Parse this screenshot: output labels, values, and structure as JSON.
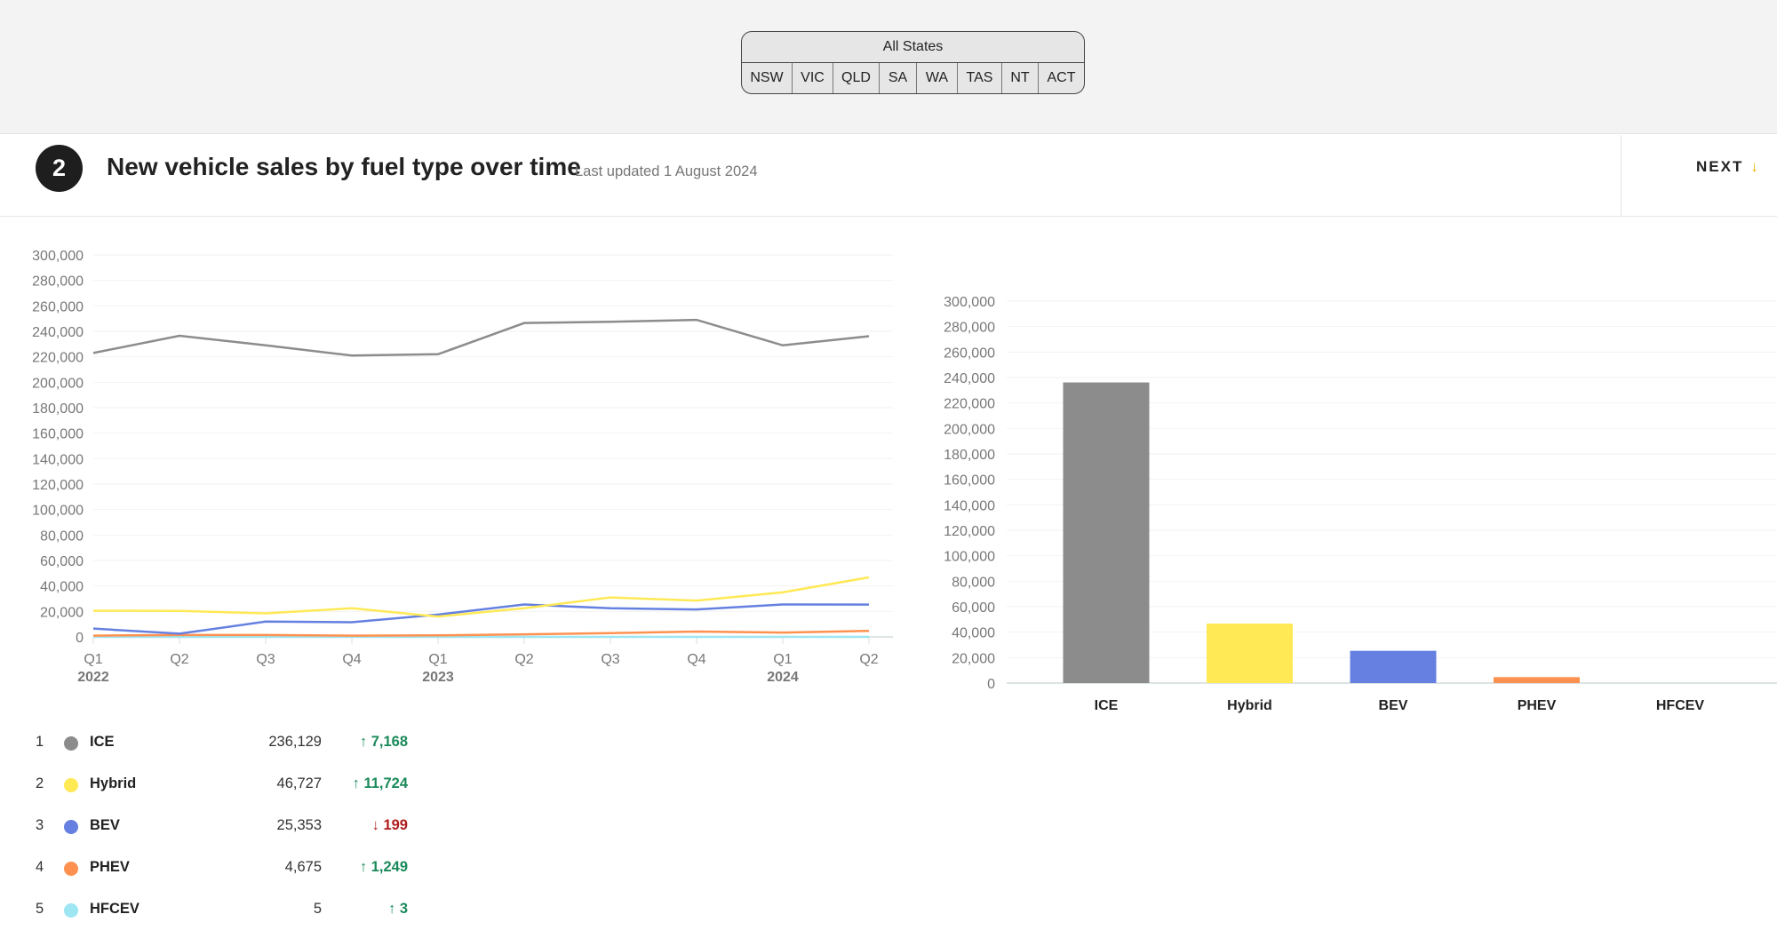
{
  "state_selector": {
    "all_label": "All States",
    "states": [
      "NSW",
      "VIC",
      "QLD",
      "SA",
      "WA",
      "TAS",
      "NT",
      "ACT"
    ]
  },
  "section": {
    "number": "2",
    "title": "New vehicle sales by fuel type over time",
    "last_updated": "Last updated 1 August 2024",
    "next_label": "NEXT",
    "next_icon": "arrow-down-icon"
  },
  "colors": {
    "ICE": "#8c8c8c",
    "Hybrid": "#ffe955",
    "BEV": "#6580e0",
    "PHEV": "#ff9150",
    "HFCEV": "#9de6f2",
    "up": "#1a8a5a",
    "down": "#b01c1c"
  },
  "chart_data": [
    {
      "type": "line",
      "x": [
        "Q1",
        "Q2",
        "Q3",
        "Q4",
        "Q1",
        "Q2",
        "Q3",
        "Q4",
        "Q1",
        "Q2"
      ],
      "year_labels": [
        {
          "index": 0,
          "label": "2022"
        },
        {
          "index": 4,
          "label": "2023"
        },
        {
          "index": 8,
          "label": "2024"
        }
      ],
      "ylim": [
        0,
        300000
      ],
      "yticks": [
        "0",
        "20,000",
        "40,000",
        "60,000",
        "80,000",
        "100,000",
        "120,000",
        "140,000",
        "160,000",
        "180,000",
        "200,000",
        "220,000",
        "240,000",
        "260,000",
        "280,000",
        "300,000"
      ],
      "grid": true,
      "series": [
        {
          "name": "ICE",
          "values": [
            223000,
            236500,
            229000,
            221000,
            222000,
            246500,
            247500,
            249000,
            229000,
            236129
          ]
        },
        {
          "name": "Hybrid",
          "values": [
            20500,
            20400,
            18500,
            22500,
            16000,
            22500,
            31000,
            28500,
            35000,
            46727
          ]
        },
        {
          "name": "BEV",
          "values": [
            6500,
            2500,
            12000,
            11500,
            17500,
            25500,
            22500,
            21500,
            25500,
            25353
          ]
        },
        {
          "name": "PHEV",
          "values": [
            1000,
            1500,
            1500,
            1000,
            1200,
            2000,
            3000,
            4200,
            3400,
            4675
          ]
        },
        {
          "name": "HFCEV",
          "values": [
            1,
            2,
            2,
            1,
            1,
            2,
            2,
            3,
            2,
            5
          ]
        }
      ]
    },
    {
      "type": "bar",
      "categories": [
        "ICE",
        "Hybrid",
        "BEV",
        "PHEV",
        "HFCEV"
      ],
      "values": [
        236129,
        46727,
        25353,
        4675,
        5
      ],
      "ylim": [
        0,
        300000
      ],
      "yticks": [
        "0",
        "20,000",
        "40,000",
        "60,000",
        "80,000",
        "100,000",
        "120,000",
        "140,000",
        "160,000",
        "180,000",
        "200,000",
        "220,000",
        "240,000",
        "260,000",
        "280,000",
        "300,000"
      ],
      "grid": true
    }
  ],
  "legend": [
    {
      "rank": "1",
      "name": "ICE",
      "value": "236,129",
      "change": "↑ 7,168",
      "direction": "up"
    },
    {
      "rank": "2",
      "name": "Hybrid",
      "value": "46,727",
      "change": "↑ 11,724",
      "direction": "up"
    },
    {
      "rank": "3",
      "name": "BEV",
      "value": "25,353",
      "change": "↓ 199",
      "direction": "down"
    },
    {
      "rank": "4",
      "name": "PHEV",
      "value": "4,675",
      "change": "↑ 1,249",
      "direction": "up"
    },
    {
      "rank": "5",
      "name": "HFCEV",
      "value": "5",
      "change": "↑ 3",
      "direction": "up"
    }
  ]
}
